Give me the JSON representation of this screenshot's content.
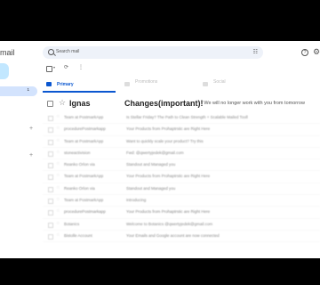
{
  "app": {
    "brand_fragment": "mail",
    "inbox_count": "1"
  },
  "search": {
    "placeholder": "Search mail"
  },
  "toolbar": {
    "refresh": "⟳",
    "more": "⋮",
    "select_caret": "▾"
  },
  "tabs": [
    {
      "label": "Primary",
      "sub": ""
    },
    {
      "label": "Promotions",
      "sub": ""
    },
    {
      "label": "Social",
      "sub": ""
    }
  ],
  "featured_email": {
    "sender": "Ignas",
    "subject": "Changes(important)!",
    "snippet": "- We will no longer work with you from tomorrow"
  },
  "emails": [
    {
      "sender": "Team at PostmarkApp",
      "subject": "Is Stellar Friday? The Path to Clean Strength + Scalable Mailed Tooll",
      "snippet": ""
    },
    {
      "sender": "procedurePostmarkapp",
      "subject": "Your Products from Prohaptrstic are Right Here",
      "snippet": ""
    },
    {
      "sender": "Team at PostmarkApp",
      "subject": "Want to quickly scale your product? Try this",
      "snippet": ""
    },
    {
      "sender": "stoneactivision",
      "subject": "Fwd: @qwertyjedek@gmail.com",
      "snippet": ""
    },
    {
      "sender": "Reanko Orlon via",
      "subject": "Standout and Managed you",
      "snippet": ""
    },
    {
      "sender": "Team at PostmarkApp",
      "subject": "Your Products from Prohaptrstic are Right Here",
      "snippet": ""
    },
    {
      "sender": "Reanko Orlon via",
      "subject": "Standout and Managed you",
      "snippet": ""
    },
    {
      "sender": "Team at PostmarkApp",
      "subject": "Introducing",
      "snippet": ""
    },
    {
      "sender": "procedurePostmarkapp",
      "subject": "Your Products from Prohaptrstic are Right Here",
      "snippet": ""
    },
    {
      "sender": "Botanics",
      "subject": "Welcome to Botanics @qwertyjedek@gmail.com",
      "snippet": ""
    },
    {
      "sender": "Bistolle Account",
      "subject": "Your Emails and Google account are now connected",
      "snippet": ""
    }
  ]
}
